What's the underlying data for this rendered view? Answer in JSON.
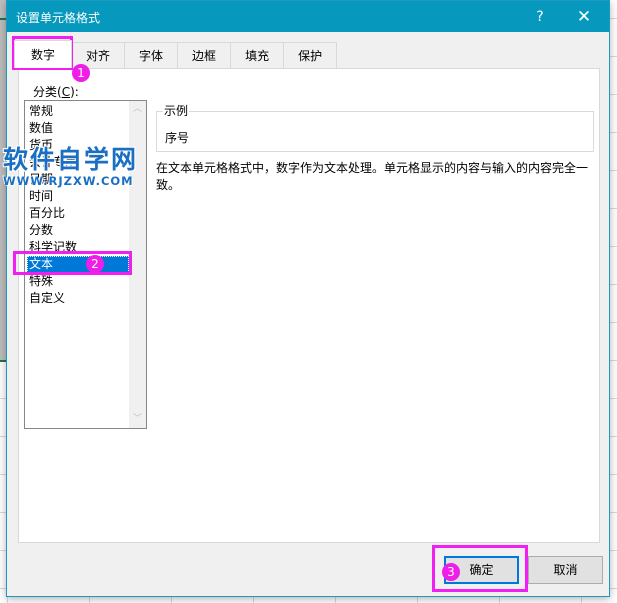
{
  "dialog": {
    "title": "设置单元格格式",
    "help_label": "?",
    "close_label": "✕"
  },
  "tabs": [
    {
      "label": "数字",
      "active": true
    },
    {
      "label": "对齐",
      "active": false
    },
    {
      "label": "字体",
      "active": false
    },
    {
      "label": "边框",
      "active": false
    },
    {
      "label": "填充",
      "active": false
    },
    {
      "label": "保护",
      "active": false
    }
  ],
  "category": {
    "label_prefix": "分类(",
    "label_accel": "C",
    "label_suffix": "):",
    "items": [
      "常规",
      "数值",
      "货币",
      "会计专用",
      "日期",
      "时间",
      "百分比",
      "分数",
      "科学记数",
      "文本",
      "特殊",
      "自定义"
    ],
    "selected": "文本",
    "scroll_up_icon": "︿",
    "scroll_down_icon": "﹀"
  },
  "sample": {
    "legend": "示例",
    "value": "序号"
  },
  "description": "在文本单元格格式中，数字作为文本处理。单元格显示的内容与输入的内容完全一致。",
  "buttons": {
    "ok": "确定",
    "cancel": "取消"
  },
  "annotations": {
    "step1": "1",
    "step2": "2",
    "step3": "3",
    "color": "#f21ff2"
  },
  "watermark": {
    "title": "软件自学网",
    "url": "WWW.RJZXW.COM"
  },
  "colors": {
    "titlebar": "#0799bd",
    "selection": "#0078d7",
    "annotation": "#f21ff2"
  }
}
